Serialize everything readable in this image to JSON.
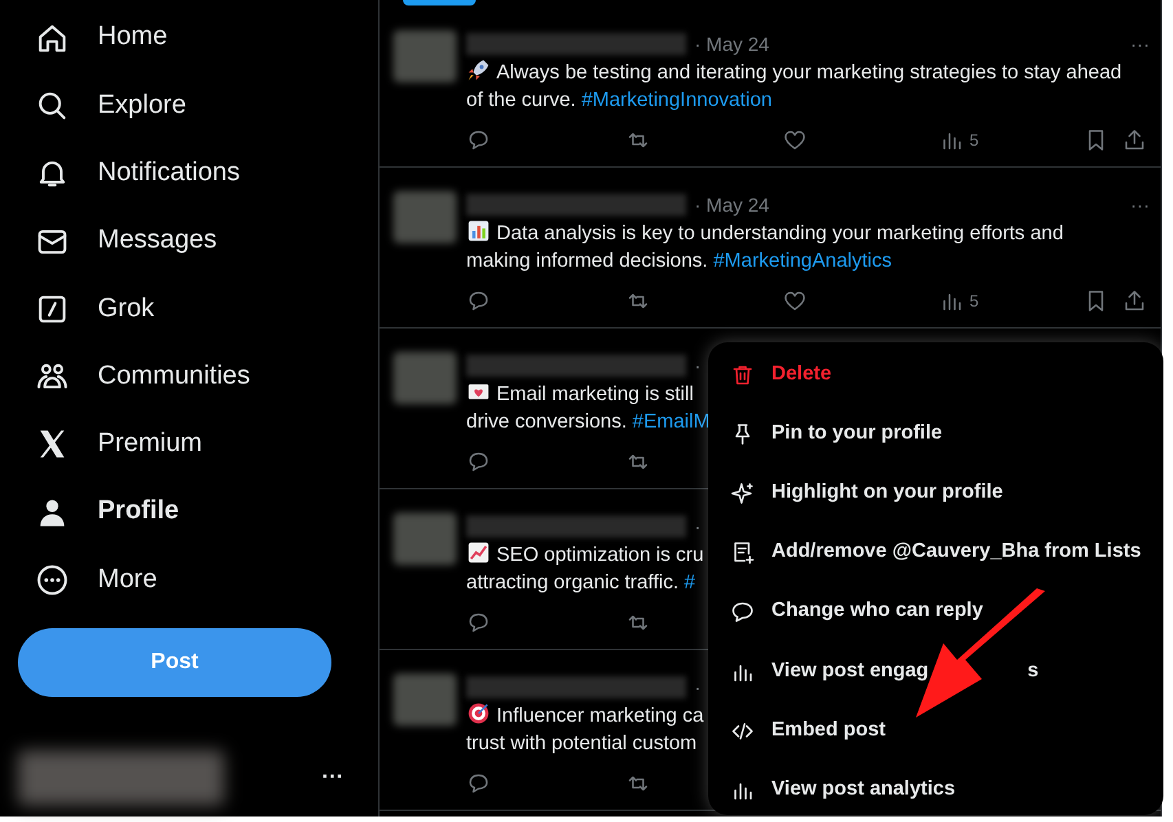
{
  "sidebar": {
    "items": [
      {
        "label": "Home",
        "selected": false
      },
      {
        "label": "Explore",
        "selected": false
      },
      {
        "label": "Notifications",
        "selected": false
      },
      {
        "label": "Messages",
        "selected": false
      },
      {
        "label": "Grok",
        "selected": false
      },
      {
        "label": "Communities",
        "selected": false
      },
      {
        "label": "Premium",
        "selected": false
      },
      {
        "label": "Profile",
        "selected": true
      },
      {
        "label": "More",
        "selected": false
      }
    ],
    "post_button": "Post",
    "account_more": "···"
  },
  "posts": [
    {
      "date": "· May 24",
      "more": "···",
      "lines": [
        {
          "text": "Always be testing and iterating your marketing strategies to stay ahead"
        },
        {
          "text": "of the curve. ",
          "hashtag": "#MarketingInnovation"
        }
      ],
      "views": "5"
    },
    {
      "date": "· May 24",
      "more": "···",
      "lines": [
        {
          "text": "Data analysis is key to understanding your marketing efforts and"
        },
        {
          "text": "making informed decisions. ",
          "hashtag": "#MarketingAnalytics"
        }
      ],
      "views": "5"
    },
    {
      "date": "·",
      "lines": [
        {
          "text": "Email marketing is still"
        },
        {
          "text": "drive conversions. ",
          "hashtag": "#EmailM"
        }
      ]
    },
    {
      "date": "·",
      "lines": [
        {
          "text": "SEO optimization is cru"
        },
        {
          "text": "attracting organic traffic. ",
          "hashtag": "#"
        }
      ]
    },
    {
      "date": "·",
      "lines": [
        {
          "text": "Influencer marketing ca"
        },
        {
          "text": "trust with potential custom"
        }
      ]
    }
  ],
  "menu": {
    "items": [
      {
        "label": "Delete",
        "kind": "danger"
      },
      {
        "label": "Pin to your profile",
        "kind": "normal"
      },
      {
        "label": "Highlight on your profile",
        "kind": "normal"
      },
      {
        "label": "Add/remove @Cauvery_Bha from Lists",
        "kind": "normal"
      },
      {
        "label": "Change who can reply",
        "kind": "normal"
      },
      {
        "label": "View post engag",
        "tail": "s",
        "kind": "normal"
      },
      {
        "label": "Embed post",
        "kind": "normal"
      },
      {
        "label": "View post analytics",
        "kind": "normal"
      }
    ]
  }
}
